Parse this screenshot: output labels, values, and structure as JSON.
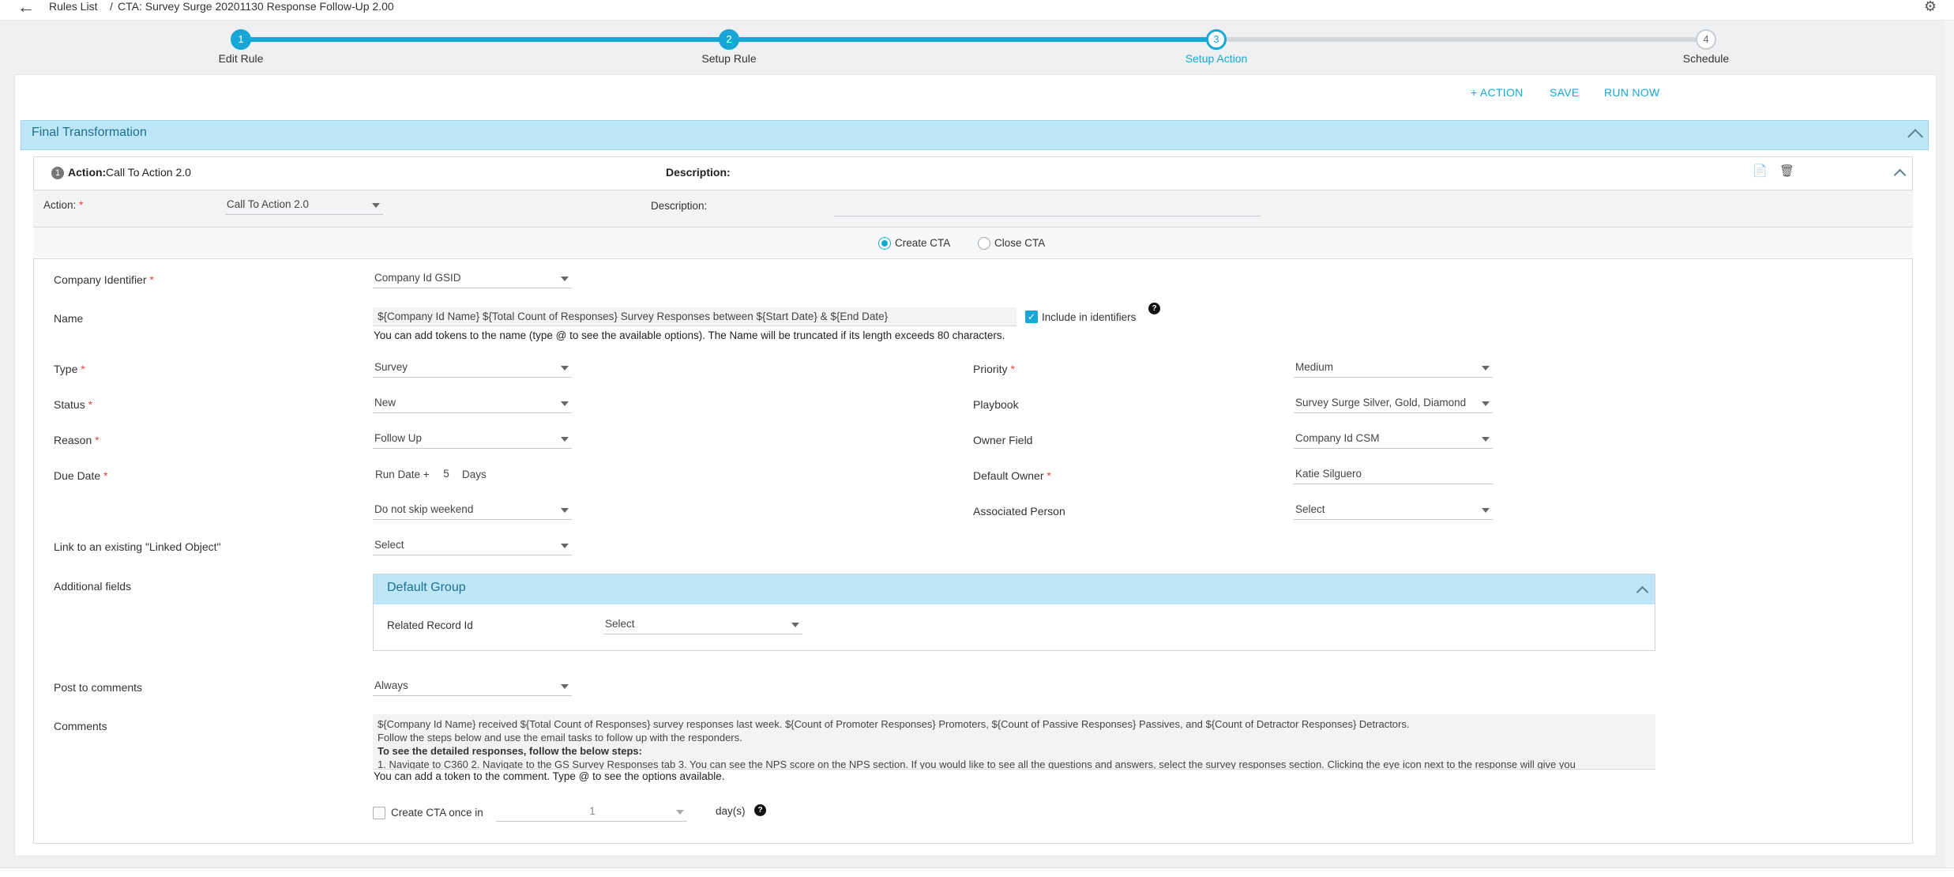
{
  "breadcrumb": {
    "root": "Rules List",
    "separator": "/",
    "current": "CTA: Survey Surge 20201130 Response Follow-Up 2.00"
  },
  "stepper": {
    "steps": [
      {
        "num": "1",
        "label": "Edit Rule"
      },
      {
        "num": "2",
        "label": "Setup Rule"
      },
      {
        "num": "3",
        "label": "Setup Action"
      },
      {
        "num": "4",
        "label": "Schedule"
      }
    ],
    "current_step": 3
  },
  "toolbar": {
    "add_action": "+ ACTION",
    "save": "SAVE",
    "run_now": "RUN NOW"
  },
  "section": {
    "title": "Final Transformation"
  },
  "action_header": {
    "num": "1",
    "action_label": "Action:",
    "action_value": "Call To Action 2.0",
    "description_label": "Description:"
  },
  "action_row": {
    "action_label": "Action:",
    "action_value": "Call To Action 2.0",
    "description_label": "Description:",
    "description_value": ""
  },
  "cta_mode": {
    "create": "Create CTA",
    "close": "Close CTA",
    "selected": "create"
  },
  "form": {
    "company_identifier": {
      "label": "Company Identifier",
      "value": "Company Id GSID"
    },
    "name": {
      "label": "Name",
      "value": "${Company Id Name} ${Total Count of Responses} Survey Responses between ${Start Date} & ${End Date}",
      "include_label": "Include in identifiers",
      "include_checked": true,
      "hint": "You can add tokens to the name (type @ to see the available options). The Name will be truncated if its length exceeds 80 characters."
    },
    "type": {
      "label": "Type",
      "value": "Survey"
    },
    "status": {
      "label": "Status",
      "value": "New"
    },
    "reason": {
      "label": "Reason",
      "value": "Follow Up"
    },
    "due_date": {
      "label": "Due Date",
      "prefix": "Run Date +",
      "days": "5",
      "suffix": "Days",
      "skip_value": "Do not skip weekend"
    },
    "linked_object": {
      "label": "Link to an existing \"Linked Object\"",
      "value": "Select"
    },
    "priority": {
      "label": "Priority",
      "value": "Medium"
    },
    "playbook": {
      "label": "Playbook",
      "value": "Survey Surge Silver, Gold, Diamond"
    },
    "owner_field": {
      "label": "Owner Field",
      "value": "Company Id CSM"
    },
    "default_owner": {
      "label": "Default Owner",
      "value": "Katie Silguero"
    },
    "associated_person": {
      "label": "Associated Person",
      "value": "Select"
    },
    "additional_fields": {
      "label": "Additional fields",
      "group_title": "Default Group",
      "related_record_label": "Related Record Id",
      "related_record_value": "Select"
    },
    "post_to_comments": {
      "label": "Post to comments",
      "value": "Always"
    },
    "comments": {
      "label": "Comments",
      "lines": [
        "${Company Id Name} received ${Total Count of Responses} survey responses last week. ${Count of Promoter Responses} Promoters, ${Count of Passive Responses} Passives, and ${Count of Detractor Responses} Detractors.",
        "Follow the steps below and use the email tasks to follow up with the responders.",
        "To see the detailed responses, follow the below steps:",
        "1. Navigate to C360 2. Navigate to the GS Survey Responses tab 3. You can see the NPS score on the NPS section. If you would like to see all the questions and answers, select the survey responses section. Clicking the eye icon next to the response will give you"
      ],
      "hint": "You can add a token to the comment. Type @ to see the options available."
    },
    "create_once": {
      "label": "Create CTA once in",
      "value": "1",
      "suffix": "day(s)",
      "checked": false
    }
  },
  "colors": {
    "accent": "#17a7d6",
    "section_header": "#bde6f6",
    "required": "#e0463c"
  }
}
